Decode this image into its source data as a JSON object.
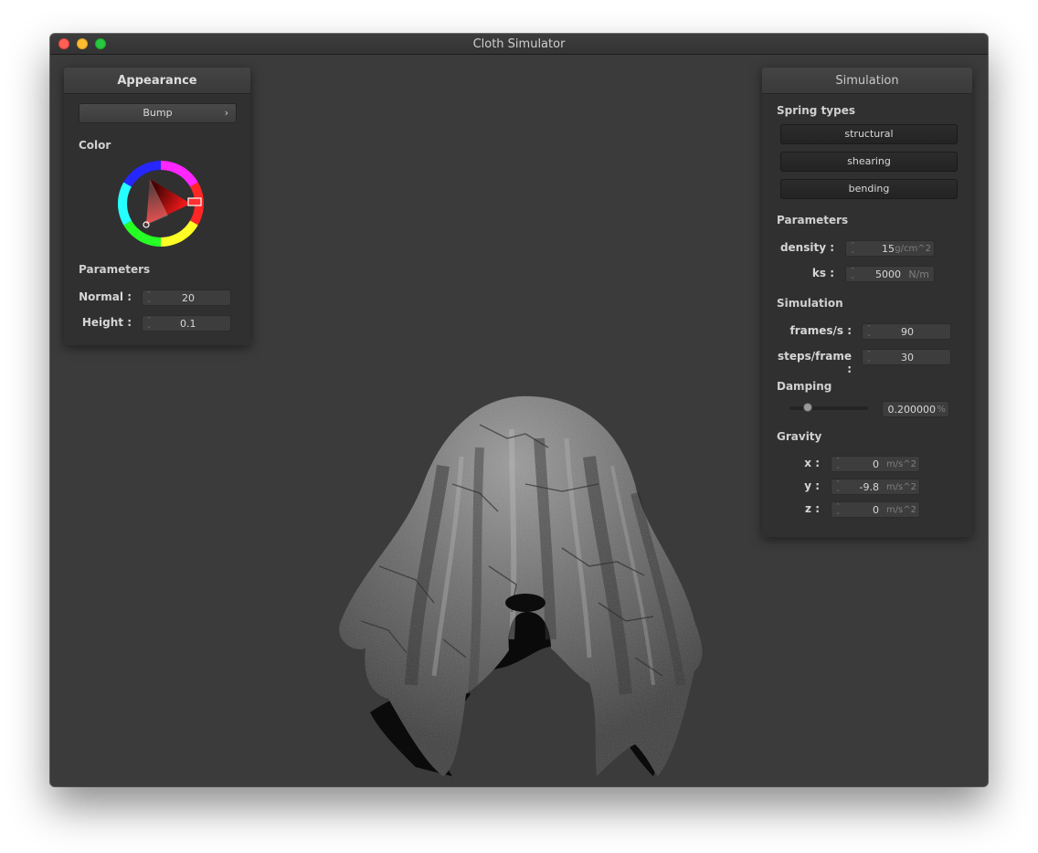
{
  "window": {
    "title": "Cloth Simulator"
  },
  "appearance": {
    "title": "Appearance",
    "shader_dropdown": {
      "value": "Bump",
      "chevron": "›"
    },
    "color_label": "Color",
    "parameters_label": "Parameters",
    "normal": {
      "label": "Normal :",
      "value": "20"
    },
    "height": {
      "label": "Height :",
      "value": "0.1"
    }
  },
  "simulation": {
    "title": "Simulation",
    "spring_types_label": "Spring types",
    "spring_types": {
      "structural": "structural",
      "shearing": "shearing",
      "bending": "bending"
    },
    "parameters_label": "Parameters",
    "density": {
      "label": "density :",
      "value": "15",
      "unit": "g/cm^2"
    },
    "ks": {
      "label": "ks :",
      "value": "5000",
      "unit": "N/m"
    },
    "simulation_label": "Simulation",
    "frames": {
      "label": "frames/s :",
      "value": "90"
    },
    "steps": {
      "label": "steps/frame :",
      "value": "30"
    },
    "damping_label": "Damping",
    "damping": {
      "value": "0.200000",
      "unit": "%",
      "slider_fraction": 0.2
    },
    "gravity_label": "Gravity",
    "gravity": {
      "x": {
        "label": "x :",
        "value": "0",
        "unit": "m/s^2"
      },
      "y": {
        "label": "y :",
        "value": "-9.8",
        "unit": "m/s^2"
      },
      "z": {
        "label": "z :",
        "value": "0",
        "unit": "m/s^2"
      }
    }
  },
  "icons": {
    "spinner": "spinner-arrows-icon",
    "dropdown": "chevron-right-icon"
  }
}
